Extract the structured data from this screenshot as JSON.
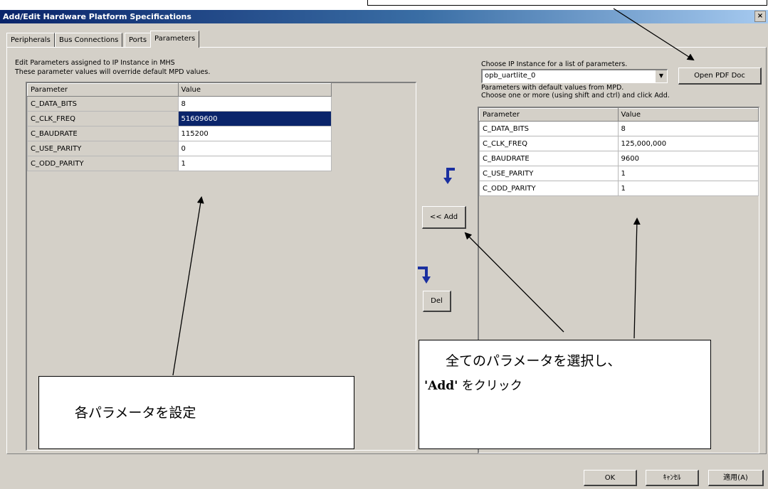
{
  "window": {
    "title": "Add/Edit Hardware Platform Specifications",
    "close_glyph": "×"
  },
  "tabs": [
    {
      "label": "Peripherals"
    },
    {
      "label": "Bus Connections"
    },
    {
      "label": "Ports"
    },
    {
      "label": "Parameters",
      "active": true
    }
  ],
  "left_panel": {
    "note_line1": "Edit Parameters assigned to IP Instance in MHS",
    "note_line2": "These parameter values will override default MPD values.",
    "columns": [
      "Parameter",
      "Value"
    ],
    "rows": [
      {
        "param": "C_DATA_BITS",
        "value": "8"
      },
      {
        "param": "C_CLK_FREQ",
        "value": "51609600",
        "selected": true
      },
      {
        "param": "C_BAUDRATE",
        "value": "115200"
      },
      {
        "param": "C_USE_PARITY",
        "value": "0"
      },
      {
        "param": "C_ODD_PARITY",
        "value": "1"
      }
    ]
  },
  "middle": {
    "add_label": "<< Add",
    "del_label": "Del",
    "arrow_color": "#1a2fa0"
  },
  "right_panel": {
    "choose_label": "Choose IP Instance for a list of parameters.",
    "instance_value": "opb_uartlite_0",
    "open_pdf_label": "Open PDF Doc",
    "note_line1": "Parameters with default values from MPD.",
    "note_line2": "Choose one or more (using shift and ctrl) and click Add.",
    "columns": [
      "Parameter",
      "Value"
    ],
    "rows": [
      {
        "param": "C_DATA_BITS",
        "value": "8"
      },
      {
        "param": "C_CLK_FREQ",
        "value": "125,000,000"
      },
      {
        "param": "C_BAUDRATE",
        "value": "9600"
      },
      {
        "param": "C_USE_PARITY",
        "value": "1"
      },
      {
        "param": "C_ODD_PARITY",
        "value": "1"
      }
    ]
  },
  "footer": {
    "ok_label": "OK",
    "cancel_label": "ｷｬﾝｾﾙ",
    "apply_label": "適用(A)"
  },
  "callouts": {
    "set_params": "各パラメータを設定",
    "select_all_line1": "全てのパラメータを選択し、",
    "select_all_add": "'Add'",
    "select_all_line2": "をクリック"
  }
}
